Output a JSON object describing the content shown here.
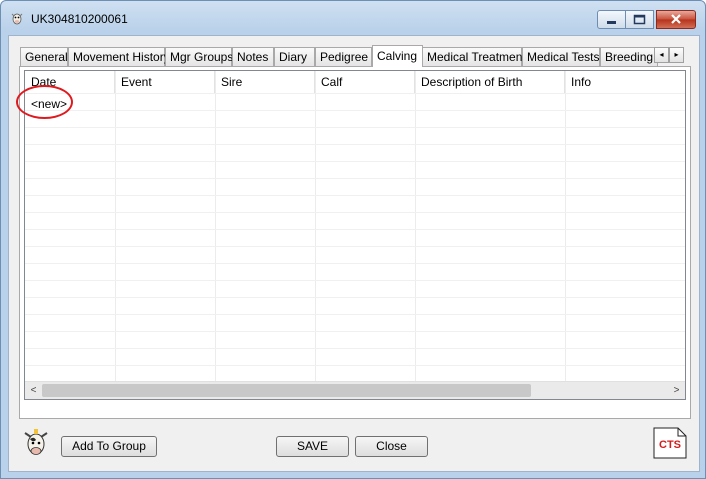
{
  "window": {
    "title": "UK304810200061",
    "icons": {
      "app": "cow-icon",
      "minimize": "minimize-icon",
      "maximize": "maximize-icon",
      "close": "close-icon"
    }
  },
  "tabs": {
    "items": [
      {
        "label": "General"
      },
      {
        "label": "Movement History"
      },
      {
        "label": "Mgr Groups"
      },
      {
        "label": "Notes"
      },
      {
        "label": "Diary"
      },
      {
        "label": "Pedigree"
      },
      {
        "label": "Calving",
        "active": true
      },
      {
        "label": "Medical Treatment"
      },
      {
        "label": "Medical Tests"
      },
      {
        "label": "Breeding"
      }
    ],
    "scroll_left": "◂",
    "scroll_right": "▸"
  },
  "grid": {
    "columns": [
      "Date",
      "Event",
      "Sire",
      "Calf",
      "Description of Birth",
      "Info"
    ],
    "new_row_label": "<new>"
  },
  "scrollbar": {
    "left_arrow": "<",
    "right_arrow": ">"
  },
  "buttons": {
    "add_to_group": "Add To Group",
    "save": "SAVE",
    "close": "Close"
  },
  "logos": {
    "cts_text": "CTS"
  },
  "colors": {
    "highlight": "#e0191e",
    "cts_red": "#d21d1d"
  }
}
